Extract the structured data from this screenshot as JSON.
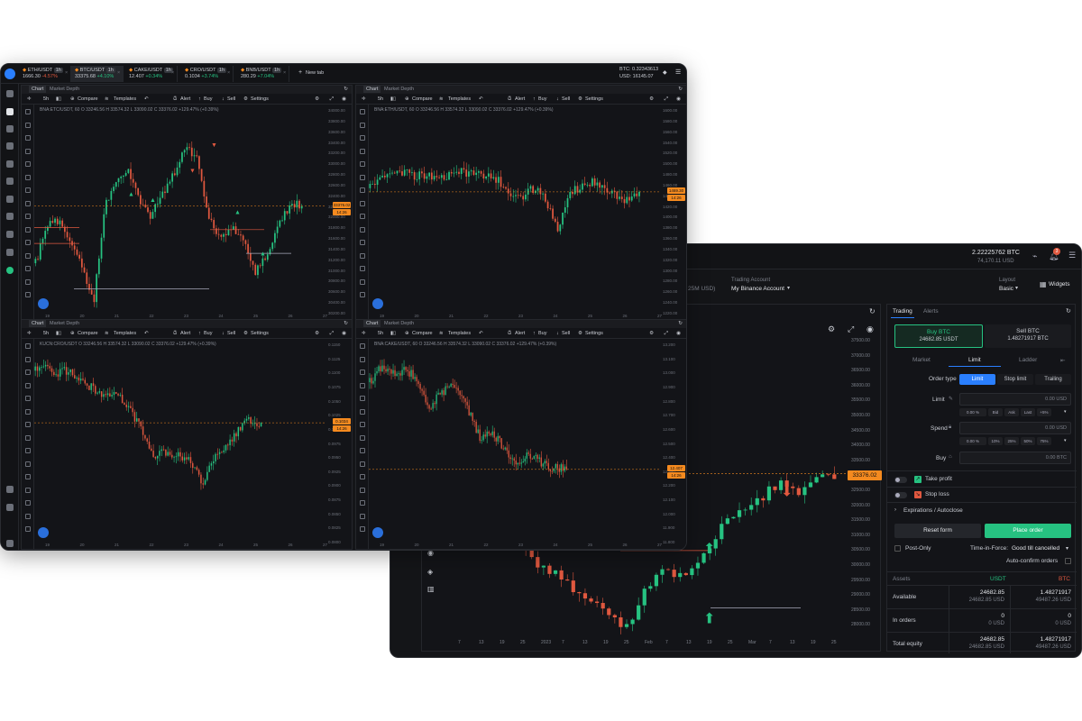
{
  "front": {
    "tickers": [
      {
        "pair": "ETH/USDT",
        "badge": "1h",
        "price": "1666.30",
        "change": "-4.57%"
      },
      {
        "pair": "BTC/USDT",
        "badge": "1h",
        "price": "33375.68",
        "change": "+4.10%"
      },
      {
        "pair": "CAKE/USDT",
        "badge": "1h",
        "price": "12.407",
        "change": "+0.34%"
      },
      {
        "pair": "CRO/USDT",
        "badge": "1h",
        "price": "0.1034",
        "change": "+3.74%"
      },
      {
        "pair": "BNB/USDT",
        "badge": "1h",
        "price": "280.29",
        "change": "+7.04%"
      }
    ],
    "new_tab": "New tab",
    "account_btc": "BTC: 0.32343613",
    "account_usd": "USD: 16145.07",
    "toolbar": {
      "interval": "5h",
      "compare": "Compare",
      "templates": "Templates",
      "alert": "Alert",
      "buy": "Buy",
      "sell": "Sell",
      "settings": "Settings"
    },
    "panel_tabs": {
      "chart": "Chart",
      "depth": "Market Depth"
    },
    "panels": [
      {
        "ohlc": "BNA:ETC/USDT, 60   O 33246.56  H 33574.32  L 33090.02  C 33376.02  +129.47% (+0.39%)",
        "prices": [
          "34000.00",
          "33800.00",
          "33600.00",
          "33400.00",
          "33200.00",
          "33000.00",
          "32800.00",
          "32600.00",
          "32400.00",
          "32200.00",
          "32000.00",
          "31800.00",
          "31600.00",
          "31400.00",
          "31200.00",
          "31000.00",
          "30800.00",
          "30600.00",
          "30400.00",
          "30200.00"
        ],
        "dates": [
          "19",
          "20",
          "21",
          "22",
          "23",
          "24",
          "25",
          "26",
          "27"
        ],
        "tag": "33376.02",
        "tag2": "14:26"
      },
      {
        "ohlc": "BNA:ETH/USDT, 60   O 33246.56  H 33574.32  L 33090.02  C 33376.02  +129.47% (+0.39%)",
        "prices": [
          "1600.00",
          "1580.00",
          "1560.00",
          "1540.00",
          "1520.00",
          "1500.00",
          "1480.00",
          "1460.00",
          "1440.00",
          "1420.00",
          "1400.00",
          "1380.00",
          "1360.00",
          "1340.00",
          "1320.00",
          "1300.00",
          "1280.00",
          "1260.00",
          "1240.00",
          "1220.00"
        ],
        "dates": [
          "19",
          "20",
          "21",
          "22",
          "23",
          "24",
          "25",
          "26",
          "27"
        ],
        "tag": "1469.30",
        "tag2": "14:26"
      },
      {
        "ohlc": "KUCN:CRO/USDT   O 33246.56  H 33574.32  L 33090.02  C 33376.02  +129.47% (+0.39%)",
        "prices": [
          "0.1150",
          "0.1125",
          "0.1100",
          "0.1075",
          "0.1050",
          "0.1025",
          "0.1000",
          "0.0975",
          "0.0950",
          "0.0925",
          "0.0900",
          "0.0875",
          "0.0850",
          "0.0825",
          "0.0800"
        ],
        "dates": [
          "19",
          "20",
          "21",
          "22",
          "23",
          "24",
          "25",
          "26",
          "27"
        ],
        "tag": "0.1034",
        "tag2": "14:26"
      },
      {
        "ohlc": "BNA:CAKE/USDT, 60   O 33246.56  H 33574.32  L 33090.02  C 33376.02  +129.47% (+0.39%)",
        "prices": [
          "13.200",
          "13.100",
          "13.000",
          "12.900",
          "12.800",
          "12.700",
          "12.600",
          "12.500",
          "12.400",
          "12.300",
          "12.200",
          "12.100",
          "12.000",
          "11.900",
          "11.800"
        ],
        "dates": [
          "19",
          "20",
          "21",
          "22",
          "23",
          "24",
          "25",
          "26",
          "27"
        ],
        "tag": "12.407",
        "tag2": "14:26"
      }
    ]
  },
  "back": {
    "balance_btc": "2.22225762 BTC",
    "balance_usd": "74,170.11 USD",
    "notif_count": "3",
    "partial_left": "25M USD)",
    "trading_account_label": "Trading Account",
    "trading_account": "My Binance Account",
    "layout_label": "Layout",
    "layout_value": "Basic",
    "widgets": "Widgets",
    "prices": [
      "37500.00",
      "37000.00",
      "36500.00",
      "36000.00",
      "35500.00",
      "35000.00",
      "34500.00",
      "34000.00",
      "33500.00",
      "33000.00",
      "32500.00",
      "32000.00",
      "31500.00",
      "31000.00",
      "30500.00",
      "30000.00",
      "29500.00",
      "29000.00",
      "28500.00",
      "28000.00"
    ],
    "last_price": "33376.02",
    "dates": [
      "7",
      "13",
      "19",
      "25",
      "2023",
      "7",
      "13",
      "19",
      "25",
      "Feb",
      "7",
      "13",
      "19",
      "25",
      "Mar",
      "7",
      "13",
      "19",
      "25"
    ],
    "trading": {
      "tab_trading": "Trading",
      "tab_alerts": "Alerts",
      "buy_title": "Buy BTC",
      "buy_value": "24682.85 USDT",
      "sell_title": "Sell BTC",
      "sell_value": "1.48271917 BTC",
      "order_tabs": [
        "Market",
        "Limit",
        "Ladder"
      ],
      "order_type_label": "Order type",
      "order_types": [
        "Limit",
        "Stop limit",
        "Trailing"
      ],
      "limit_label": "Limit",
      "limit_value": "0.00 USD",
      "limit_chips": [
        "0.00 %",
        "Bid",
        "Ask",
        "Last",
        "+5%"
      ],
      "spend_label": "Spend",
      "spend_value": "0.00 USD",
      "spend_chips": [
        "0.00 %",
        "10%",
        "25%",
        "50%",
        "75%"
      ],
      "buy_label": "Buy",
      "buy_amount": "0.00 BTC",
      "take_profit": "Take profit",
      "stop_loss": "Stop loss",
      "expirations": "Expirations / Autoclose",
      "reset": "Reset form",
      "place": "Place order",
      "post_only": "Post-Only",
      "tif_label": "Time-in-Force:",
      "tif_value": "Good till cancelled",
      "auto_confirm": "Auto-confirm orders"
    },
    "assets": {
      "header": "Assets",
      "col1": "USDT",
      "col2": "BTC",
      "rows": [
        {
          "label": "Available",
          "c1a": "24682.85",
          "c1b": "24682.85 USD",
          "c2a": "1.48271917",
          "c2b": "49487.26 USD"
        },
        {
          "label": "In orders",
          "c1a": "0",
          "c1b": "0 USD",
          "c2a": "0",
          "c2b": "0 USD"
        },
        {
          "label": "Total equity",
          "c1a": "24682.85",
          "c1b": "24682.85 USD",
          "c2a": "1.48271917",
          "c2b": "49487.26 USD"
        }
      ]
    }
  },
  "colors": {
    "up": "#26c281",
    "down": "#e0583f",
    "accent": "#f58a1f",
    "blue": "#2a7fff",
    "bg": "#141518"
  }
}
